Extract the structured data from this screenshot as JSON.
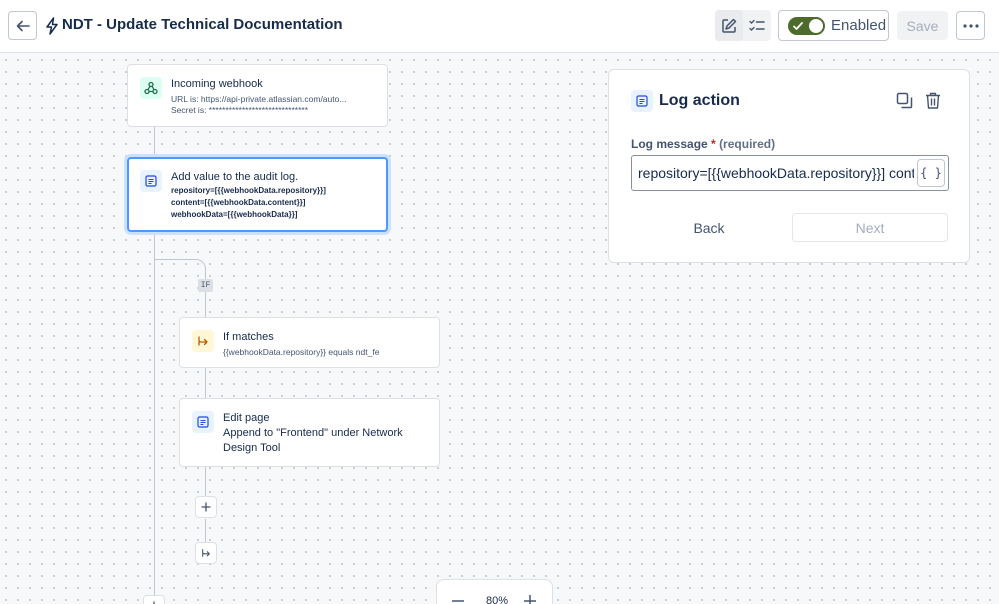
{
  "header": {
    "title": "NDT - Update Technical Documentation",
    "enabled_label": "Enabled",
    "save_label": "Save"
  },
  "canvas": {
    "trigger": {
      "title": "Incoming webhook",
      "url_line": "URL is: https://api-private.atlassian.com/auto...",
      "secret_line": "Secret is: ******************************"
    },
    "log_card": {
      "title": "Add value to the audit log.",
      "line1": "repository=[{{webhookData.repository}}]",
      "line2": "content=[{{webhookData.content}}]",
      "line3": "webhookData=[{{webhookData}}]"
    },
    "if_badge": "IF",
    "condition": {
      "title": "If matches",
      "detail": "{{webhookData.repository}} equals ndt_fe"
    },
    "edit_page": {
      "title": "Edit page",
      "desc": "Append to \"Frontend\" under Network Design Tool"
    },
    "zoom": "80%"
  },
  "panel": {
    "title": "Log action",
    "field_label": "Log message",
    "required_star": "*",
    "required_text": "(required)",
    "field_value": "repository=[{{webhookData.repository}}] content=[{{webhookData.content}}] webhookData=[{{webhookData}}]",
    "brace_label": "{ }",
    "back_label": "Back",
    "next_label": "Next"
  },
  "colors": {
    "accent": "#4c9aff",
    "toggle_on": "#4d6b2b"
  },
  "icons": [
    "arrow-left-icon",
    "bolt-icon",
    "edit-icon",
    "checklist-icon",
    "check-icon",
    "more-icon",
    "webhook-icon",
    "log-icon",
    "branch-icon",
    "plus-icon",
    "minus-icon",
    "copy-icon",
    "trash-icon"
  ]
}
